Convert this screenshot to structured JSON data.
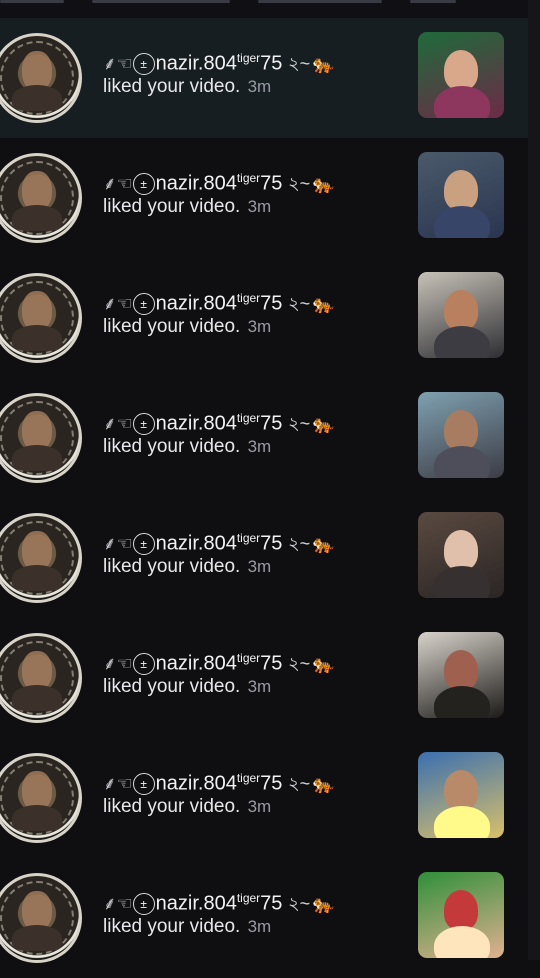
{
  "user": {
    "prefix": "⸙☜",
    "badge": "±",
    "name": "nazir.804",
    "superscript": "tiger",
    "suffix": "75",
    "trail": "২~"
  },
  "action_text": "liked your video.",
  "time_text": "3m",
  "notifications": [
    {
      "thumb_colors": [
        "#1e6b3a",
        "#6d2a48",
        "#d9a88a"
      ]
    },
    {
      "thumb_colors": [
        "#4a5a6a",
        "#2a3550",
        "#c9a080"
      ]
    },
    {
      "thumb_colors": [
        "#c7c2b8",
        "#2e2e33",
        "#b98060"
      ]
    },
    {
      "thumb_colors": [
        "#7fa0b0",
        "#3c3c45",
        "#a87c60"
      ]
    },
    {
      "thumb_colors": [
        "#5a4a40",
        "#2a2525",
        "#e0c0aa"
      ]
    },
    {
      "thumb_colors": [
        "#d8d4cc",
        "#1c1a18",
        "#a06050"
      ]
    },
    {
      "thumb_colors": [
        "#3a6fb0",
        "#d9c06a",
        "#b98a6a"
      ]
    },
    {
      "thumb_colors": [
        "#2f8f3a",
        "#e0b090",
        "#c43a3a"
      ]
    }
  ],
  "colors": {
    "background": "#0f0f12",
    "highlight_row": "#161e22",
    "muted_text": "#9a9aa4"
  }
}
